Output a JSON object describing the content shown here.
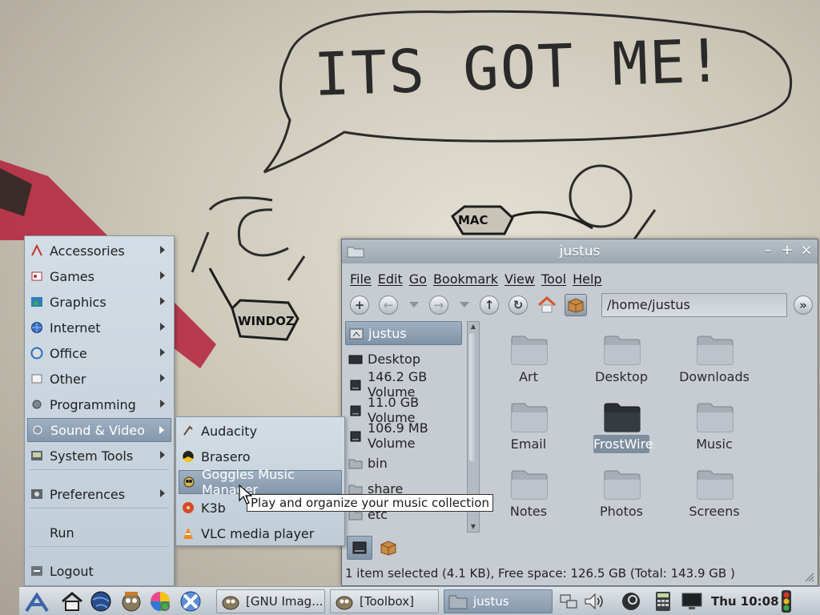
{
  "wallpaper": {
    "bubble_text": "ITS GOT ME!",
    "mac_label": "MAC",
    "windoz_label": "WINDOZ"
  },
  "main_menu": {
    "items": [
      {
        "label": "Accessories",
        "icon": "accessories-icon",
        "has_submenu": true
      },
      {
        "label": "Games",
        "icon": "games-icon",
        "has_submenu": true
      },
      {
        "label": "Graphics",
        "icon": "graphics-icon",
        "has_submenu": true
      },
      {
        "label": "Internet",
        "icon": "internet-icon",
        "has_submenu": true
      },
      {
        "label": "Office",
        "icon": "office-icon",
        "has_submenu": true
      },
      {
        "label": "Other",
        "icon": "other-icon",
        "has_submenu": true
      },
      {
        "label": "Programming",
        "icon": "programming-icon",
        "has_submenu": true
      },
      {
        "label": "Sound & Video",
        "icon": "sound-video-icon",
        "has_submenu": true,
        "active": true
      },
      {
        "label": "System Tools",
        "icon": "system-tools-icon",
        "has_submenu": true
      },
      {
        "label": "Preferences",
        "icon": "preferences-icon",
        "has_submenu": true
      },
      {
        "label": "Run",
        "icon": "",
        "has_submenu": false
      },
      {
        "label": "Logout",
        "icon": "logout-icon",
        "has_submenu": false
      }
    ]
  },
  "sub_menu": {
    "items": [
      {
        "label": "Audacity",
        "icon": "audacity-icon"
      },
      {
        "label": "Brasero",
        "icon": "brasero-icon"
      },
      {
        "label": "Goggles Music Manager",
        "icon": "goggles-icon",
        "active": true
      },
      {
        "label": "K3b",
        "icon": "k3b-icon"
      },
      {
        "label": "VLC media player",
        "icon": "vlc-icon"
      }
    ]
  },
  "tooltip": "Play and organize your music collection",
  "file_manager": {
    "title": "justus",
    "menubar": [
      "File",
      "Edit",
      "Go",
      "Bookmark",
      "View",
      "Tool",
      "Help"
    ],
    "path": "/home/justus",
    "places": [
      {
        "label": "justus",
        "icon": "home-folder-icon",
        "selected": true
      },
      {
        "label": "Desktop",
        "icon": "desktop-icon"
      },
      {
        "label": "146.2 GB Volume",
        "icon": "drive-icon"
      },
      {
        "label": "11.0 GB Volume",
        "icon": "drive-icon"
      },
      {
        "label": "106.9 MB Volume",
        "icon": "drive-icon"
      },
      {
        "label": "bin",
        "icon": "folder-icon"
      },
      {
        "label": "share",
        "icon": "folder-icon"
      },
      {
        "label": "etc",
        "icon": "folder-icon"
      }
    ],
    "folders": [
      {
        "label": "Art"
      },
      {
        "label": "Desktop"
      },
      {
        "label": "Downloads"
      },
      {
        "label": "Email"
      },
      {
        "label": "FrostWire",
        "selected": true
      },
      {
        "label": "Music"
      },
      {
        "label": "Notes"
      },
      {
        "label": "Photos"
      },
      {
        "label": "Screens"
      }
    ],
    "status": "1 item selected (4.1 KB), Free space: 126.5 GB (Total: 143.9 GB )"
  },
  "taskbar": {
    "tasks": [
      {
        "label": "[GNU Imag...",
        "active": false
      },
      {
        "label": "[Toolbox]",
        "active": false
      },
      {
        "label": "justus",
        "active": true
      }
    ],
    "clock": "Thu 10:08"
  },
  "colors": {
    "menu_bg": "#cbd5de",
    "selection": "#8597ab",
    "window_bg": "#c6ccd2"
  }
}
